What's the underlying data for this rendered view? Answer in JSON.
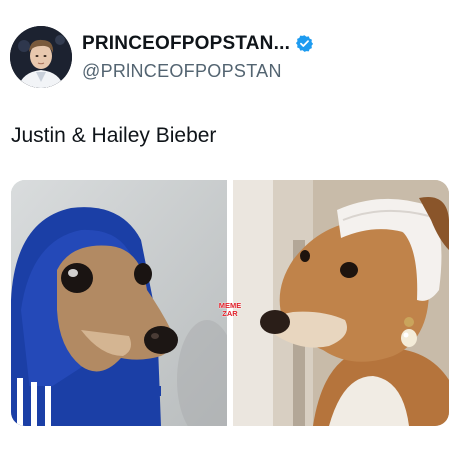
{
  "tweet": {
    "display_name": "PRINCEOFPOPSTAN...",
    "handle": "@PRlNCEOFPOPSTAN",
    "text": "Justin & Hailey Bieber",
    "verified": true,
    "verified_color": "#1d9bf0"
  },
  "media": {
    "left_image": "dog-in-blue-hoodie",
    "right_image": "dog-with-headband-and-pearl-earring",
    "watermark": [
      "MEME",
      "ZAR"
    ],
    "watermark_color": "#e0202a"
  }
}
